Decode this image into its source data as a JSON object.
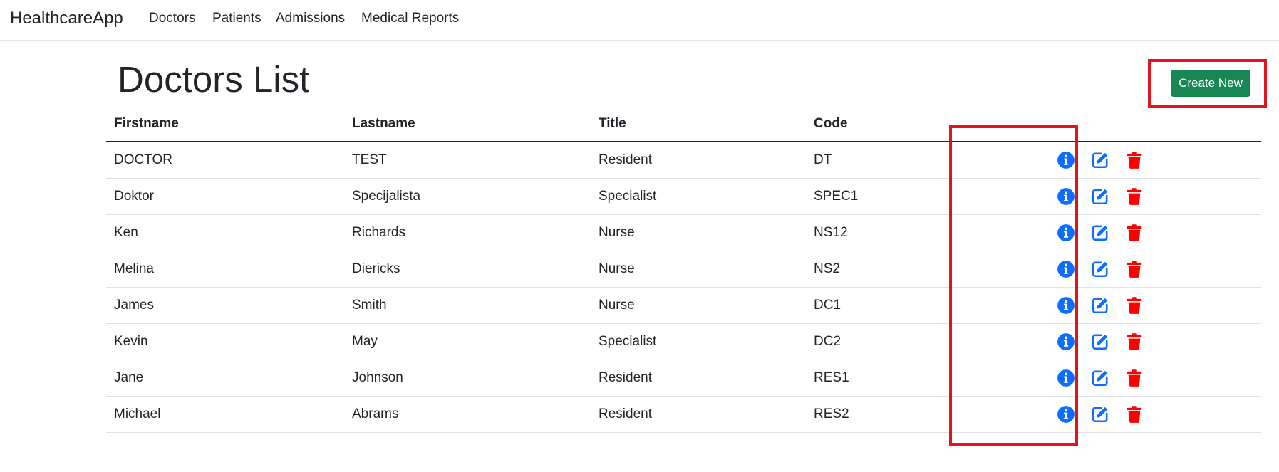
{
  "navbar": {
    "brand": "HealthcareApp",
    "links": [
      "Doctors",
      "Patients",
      "Admissions",
      "Medical Reports"
    ]
  },
  "page": {
    "title": "Doctors List",
    "create_label": "Create New"
  },
  "table": {
    "headers": [
      "Firstname",
      "Lastname",
      "Title",
      "Code"
    ],
    "rows": [
      [
        "DOCTOR",
        "TEST",
        "Resident",
        "DT"
      ],
      [
        "Doktor",
        "Specijalista",
        "Specialist",
        "SPEC1"
      ],
      [
        "Ken",
        "Richards",
        "Nurse",
        "NS12"
      ],
      [
        "Melina",
        "Diericks",
        "Nurse",
        "NS2"
      ],
      [
        "James",
        "Smith",
        "Nurse",
        "DC1"
      ],
      [
        "Kevin",
        "May",
        "Specialist",
        "DC2"
      ],
      [
        "Jane",
        "Johnson",
        "Resident",
        "RES1"
      ],
      [
        "Michael",
        "Abrams",
        "Resident",
        "RES2"
      ]
    ],
    "row_actions": [
      "info-icon",
      "edit-icon",
      "trash-icon"
    ]
  },
  "colors": {
    "accent_green": "#198754",
    "icon_blue": "#0d6efd",
    "icon_red": "#ff0000",
    "highlight_red": "#e3131e"
  }
}
